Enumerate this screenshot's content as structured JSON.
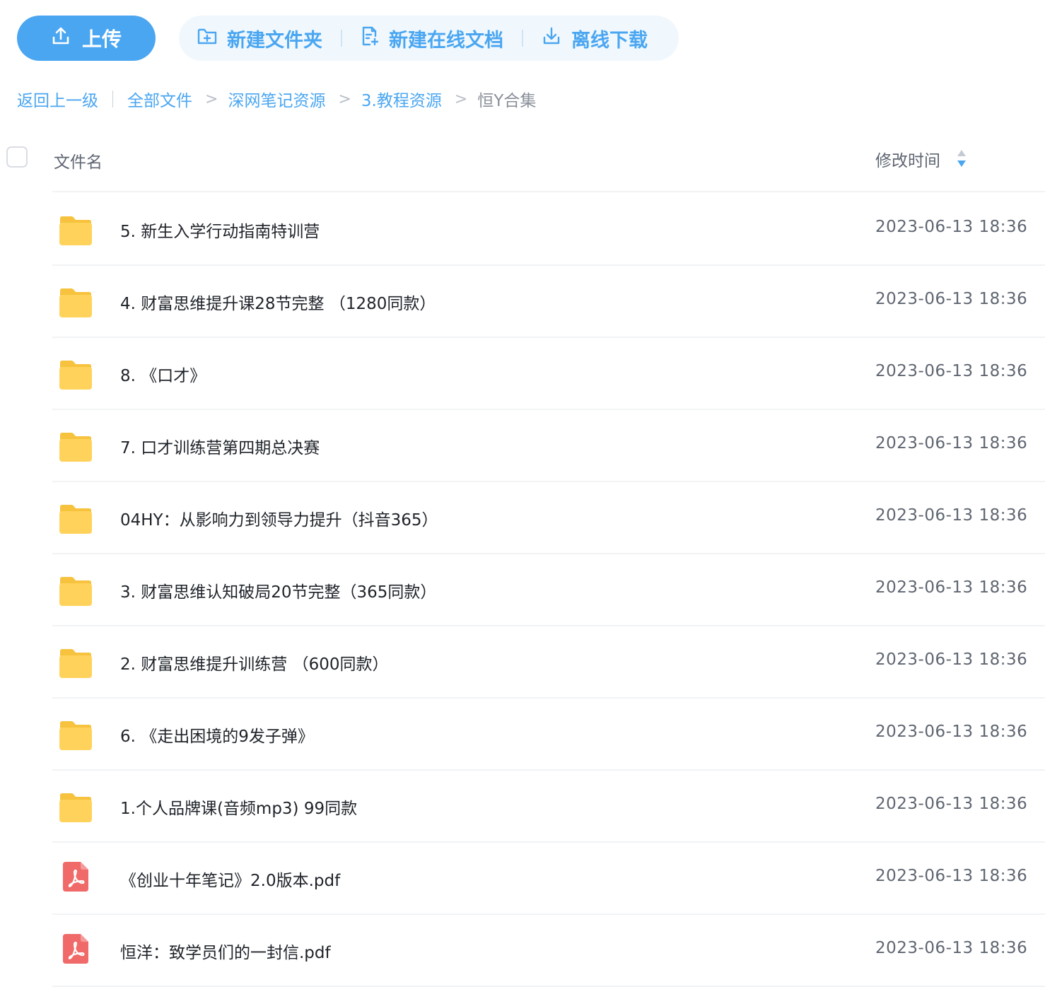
{
  "toolbar": {
    "upload_label": "上传",
    "new_folder_label": "新建文件夹",
    "new_online_doc_label": "新建在线文档",
    "offline_download_label": "离线下载"
  },
  "breadcrumb": {
    "back_label": "返回上一级",
    "path": [
      "全部文件",
      "深网笔记资源",
      "3.教程资源",
      "恒Y合集"
    ],
    "separator": ">"
  },
  "table": {
    "col_name": "文件名",
    "col_time": "修改时间",
    "rows": [
      {
        "type": "folder",
        "name": "5. 新生入学行动指南特训营",
        "time": "2023-06-13 18:36"
      },
      {
        "type": "folder",
        "name": "4. 财富思维提升课28节完整 （1280同款）",
        "time": "2023-06-13 18:36"
      },
      {
        "type": "folder",
        "name": "8. 《口才》",
        "time": "2023-06-13 18:36"
      },
      {
        "type": "folder",
        "name": "7. 口才训练营第四期总决赛",
        "time": "2023-06-13 18:36"
      },
      {
        "type": "folder",
        "name": "04HY：从影响力到领导力提升（抖音365）",
        "time": "2023-06-13 18:36"
      },
      {
        "type": "folder",
        "name": "3. 财富思维认知破局20节完整（365同款）",
        "time": "2023-06-13 18:36"
      },
      {
        "type": "folder",
        "name": "2. 财富思维提升训练营 （600同款）",
        "time": "2023-06-13 18:36"
      },
      {
        "type": "folder",
        "name": "6. 《走出困境的9发子弹》",
        "time": "2023-06-13 18:36"
      },
      {
        "type": "folder",
        "name": "1.个人品牌课(音频mp3) 99同款",
        "time": "2023-06-13 18:36"
      },
      {
        "type": "pdf",
        "name": "《创业十年笔记》2.0版本.pdf",
        "time": "2023-06-13 18:36"
      },
      {
        "type": "pdf",
        "name": "恒洋：致学员们的一封信.pdf",
        "time": "2023-06-13 18:36"
      }
    ]
  },
  "colors": {
    "accent": "#4aa6f1",
    "folder": "#ffd35b",
    "pdf": "#f06a6a"
  },
  "icons": {
    "upload": "upload-icon",
    "new_folder": "folder-plus-icon",
    "new_doc": "doc-plus-icon",
    "download": "download-icon",
    "sort": "sort-icon",
    "folder": "folder-icon",
    "pdf": "pdf-icon"
  }
}
